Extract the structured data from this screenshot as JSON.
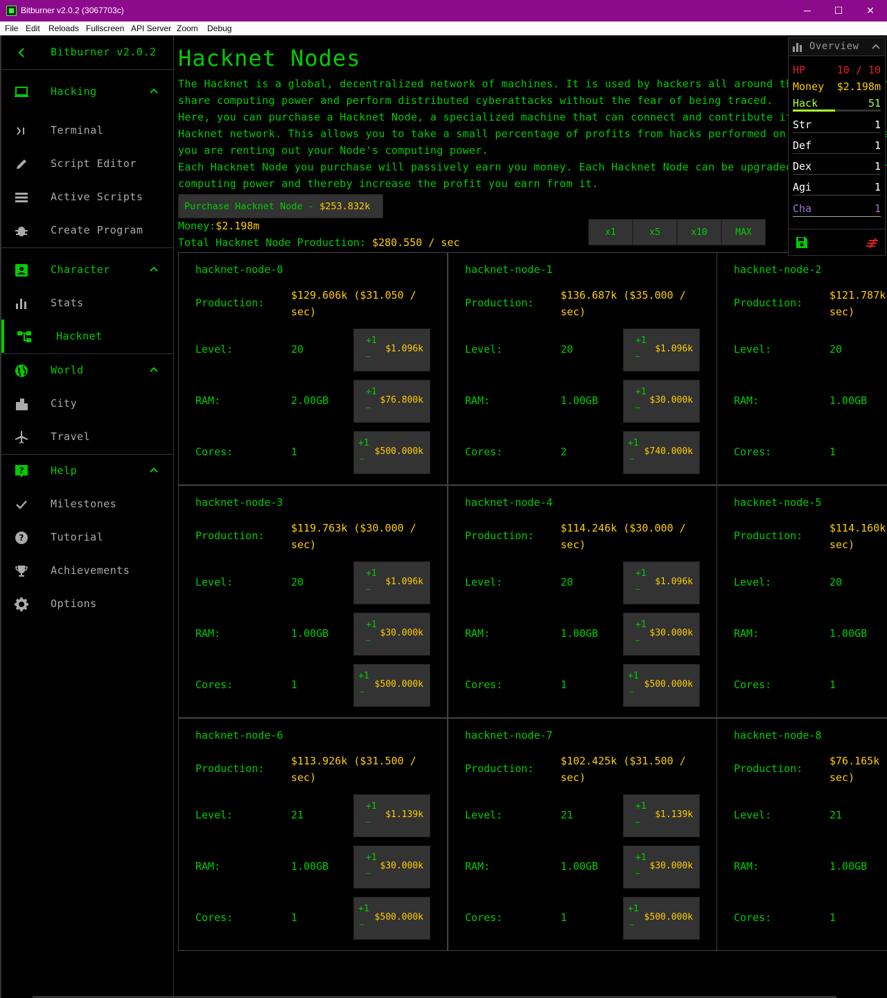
{
  "window": {
    "title": "Bitburner v2.0.2 (3067703c)",
    "min_glyph": "─",
    "max_glyph": "☐",
    "close_glyph": "✕"
  },
  "menu": [
    "File",
    "Edit",
    "Reloads",
    "Fullscreen",
    "API Server",
    "Zoom",
    "Debug"
  ],
  "sidebar": {
    "version": "Bitburner v2.0.2",
    "hacking": {
      "label": "Hacking",
      "items": [
        "Terminal",
        "Script Editor",
        "Active Scripts",
        "Create Program"
      ]
    },
    "character": {
      "label": "Character",
      "items": [
        "Stats",
        "Hacknet"
      ]
    },
    "world": {
      "label": "World",
      "items": [
        "City",
        "Travel"
      ]
    },
    "help": {
      "label": "Help",
      "items": [
        "Milestones",
        "Tutorial",
        "Achievements",
        "Options"
      ]
    }
  },
  "page": {
    "title": "Hacknet Nodes",
    "desc": [
      "The Hacknet is a global, decentralized network of machines. It is used by hackers all around the world to anonymously",
      "share computing power and perform distributed cyberattacks without the fear of being traced.",
      "Here, you can purchase a Hacknet Node, a specialized machine that can connect and contribute its resources to the",
      "Hacknet network. This allows you to take a small percentage of profits from hacks performed on the network. Essentially,",
      "you are renting out your Node's computing power.",
      "Each Hacknet Node you purchase will passively earn you money. Each Hacknet Node can be upgraded in order to increase its",
      "computing power and thereby increase the profit you earn from it."
    ],
    "purchase_label": "Purchase Hacknet Node - ",
    "purchase_price": "$253.832k",
    "money_label": "Money:",
    "money_value": "$2.198m",
    "prod_label": "Total Hacknet Node Production: ",
    "prod_value": "$280.550 / sec",
    "multipliers": [
      "x1",
      "x5",
      "x10",
      "MAX"
    ]
  },
  "node_labels": {
    "production": "Production:",
    "level": "Level:",
    "ram": "RAM:",
    "cores": "Cores:",
    "plus": "+1",
    "dash": "–"
  },
  "nodes": [
    {
      "name": "hacknet-node-0",
      "amount": "$129.606k",
      "rate": "($31.050 /",
      "sec": "sec)",
      "level": "20",
      "level_cost": "$1.096k",
      "ram": "2.00GB",
      "ram_cost": "$76.800k",
      "cores": "1",
      "cores_cost": "$500.000k"
    },
    {
      "name": "hacknet-node-1",
      "amount": "$136.687k",
      "rate": "($35.000 /",
      "sec": "sec)",
      "level": "20",
      "level_cost": "$1.096k",
      "ram": "1.00GB",
      "ram_cost": "$30.000k",
      "cores": "2",
      "cores_cost": "$740.000k"
    },
    {
      "name": "hacknet-node-2",
      "amount": "$121.787k",
      "rate": "",
      "sec": "sec)",
      "level": "20",
      "level_cost": "",
      "ram": "1.00GB",
      "ram_cost": "",
      "cores": "1",
      "cores_cost": ""
    },
    {
      "name": "hacknet-node-3",
      "amount": "$119.763k",
      "rate": "($30.000 /",
      "sec": "sec)",
      "level": "20",
      "level_cost": "$1.096k",
      "ram": "1.00GB",
      "ram_cost": "$30.000k",
      "cores": "1",
      "cores_cost": "$500.000k"
    },
    {
      "name": "hacknet-node-4",
      "amount": "$114.246k",
      "rate": "($30.000 /",
      "sec": "sec)",
      "level": "20",
      "level_cost": "$1.096k",
      "ram": "1.00GB",
      "ram_cost": "$30.000k",
      "cores": "1",
      "cores_cost": "$500.000k"
    },
    {
      "name": "hacknet-node-5",
      "amount": "$114.160k",
      "rate": "",
      "sec": "sec)",
      "level": "20",
      "level_cost": "",
      "ram": "1.00GB",
      "ram_cost": "",
      "cores": "1",
      "cores_cost": ""
    },
    {
      "name": "hacknet-node-6",
      "amount": "$113.926k",
      "rate": "($31.500 /",
      "sec": "sec)",
      "level": "21",
      "level_cost": "$1.139k",
      "ram": "1.00GB",
      "ram_cost": "$30.000k",
      "cores": "1",
      "cores_cost": "$500.000k"
    },
    {
      "name": "hacknet-node-7",
      "amount": "$102.425k",
      "rate": "($31.500 /",
      "sec": "sec)",
      "level": "21",
      "level_cost": "$1.139k",
      "ram": "1.00GB",
      "ram_cost": "$30.000k",
      "cores": "1",
      "cores_cost": "$500.000k"
    },
    {
      "name": "hacknet-node-8",
      "amount": "$76.165k",
      "rate": "",
      "sec": "sec)",
      "level": "21",
      "level_cost": "",
      "ram": "1.00GB",
      "ram_cost": "",
      "cores": "1",
      "cores_cost": ""
    }
  ],
  "overview": {
    "title": "Overview",
    "hp_label": "HP",
    "hp_value": "10 / 10",
    "money_label": "Money",
    "money_value": "$2.198m",
    "hack_label": "Hack",
    "hack_value": "51",
    "hack_progress_fraction": 0.48,
    "str_label": "Str",
    "str_value": "1",
    "def_label": "Def",
    "def_value": "1",
    "dex_label": "Dex",
    "dex_value": "1",
    "agi_label": "Agi",
    "agi_value": "1",
    "cha_label": "Cha",
    "cha_value": "1"
  },
  "colors": {
    "green": "#00cc00",
    "yellow": "#ffcc00",
    "hp_red": "#dd2222",
    "cha_purple": "#a671d1",
    "titlebar": "#8c0a8c"
  }
}
